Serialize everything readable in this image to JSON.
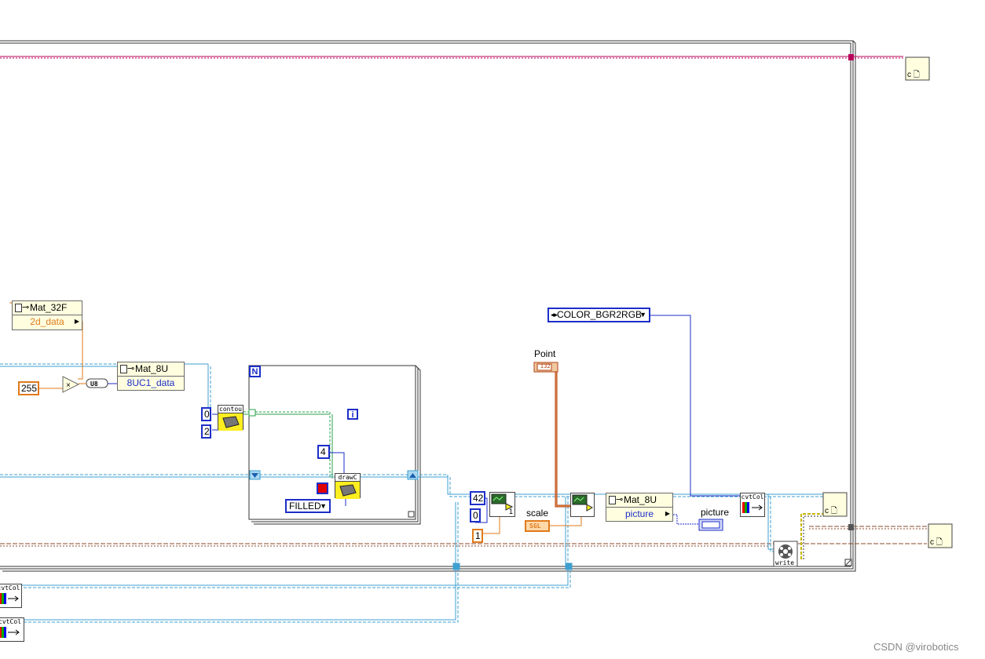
{
  "diagram": {
    "watermark": "CSDN @virobotics",
    "nodes": {
      "mat32f": {
        "title": "Mat_32F",
        "prop": "2d_data"
      },
      "mat8u_a": {
        "title": "Mat_8U",
        "prop": "8UC1_data"
      },
      "mat8u_b": {
        "title": "Mat_8U",
        "prop": "picture"
      },
      "const_255": "255",
      "u8_convert": "U8",
      "multiply": "×",
      "contours": "contou",
      "drawc": "drawC",
      "loop_n": "N",
      "loop_i": "i",
      "const_0a": "0",
      "const_2": "2",
      "const_4": "4",
      "enum_filled": "FILLED",
      "enum_color": "COLOR_BGR2RGB",
      "const_42": "42",
      "const_0b": "0",
      "const_1a": "1",
      "const_1b": "1",
      "point_label": "Point",
      "point_type": "I32",
      "scale_label": "scale",
      "scale_type": "SGL",
      "picture_label": "picture",
      "cvtcolor_a": "cvtCol",
      "cvtcolor_b": "cvtCol",
      "cvtcolor_c": "cvtCol",
      "write_label": "write",
      "ref_c": "c"
    },
    "colors": {
      "wire_blue": "#3f9fd0",
      "wire_pink": "#b8005a",
      "wire_brown": "#8b4a2b",
      "wire_orange": "#e07a1a",
      "wire_green": "#2aa04a",
      "wire_navy": "#1c2ec8",
      "frame": "#333333",
      "property_bg": "#ffffe0",
      "subvi_yellow": "#fcee21",
      "red_constant": "#e00000"
    }
  }
}
